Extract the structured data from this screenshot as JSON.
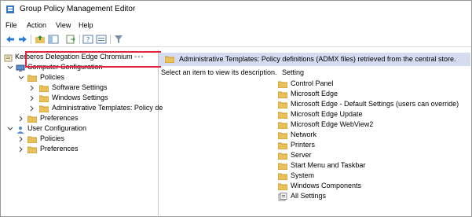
{
  "window": {
    "title": "Group Policy Management Editor"
  },
  "menu": [
    "File",
    "Action",
    "View",
    "Help"
  ],
  "toolbar": {
    "buttons": [
      "back-icon",
      "forward-icon",
      "up-folder-icon",
      "show-hide-tree-icon",
      "export-list-icon",
      "help-icon",
      "properties-icon",
      "filter-icon"
    ]
  },
  "tree": {
    "root": "Kerberos Delegation Edge Chromium",
    "computer_config": "Computer Configuration",
    "policies": "Policies",
    "software_settings": "Software Settings",
    "windows_settings": "Windows Settings",
    "admin_templates": "Administrative Templates: Policy de",
    "preferences": "Preferences",
    "user_config": "User Configuration",
    "user_policies": "Policies",
    "user_preferences": "Preferences"
  },
  "right": {
    "banner": "Administrative Templates: Policy definitions (ADMX files) retrieved from the central store.",
    "description": "Select an item to view its description.",
    "setting_header": "Setting",
    "settings": [
      "Control Panel",
      "Microsoft Edge",
      "Microsoft Edge - Default Settings (users can override)",
      "Microsoft Edge Update",
      "Microsoft Edge WebView2",
      "Network",
      "Printers",
      "Server",
      "Start Menu and Taskbar",
      "System",
      "Windows Components",
      "All Settings"
    ]
  },
  "colors": {
    "banner_bg": "#d5dcef",
    "highlight_border": "#e0253c",
    "folder": "#e8c15a"
  }
}
